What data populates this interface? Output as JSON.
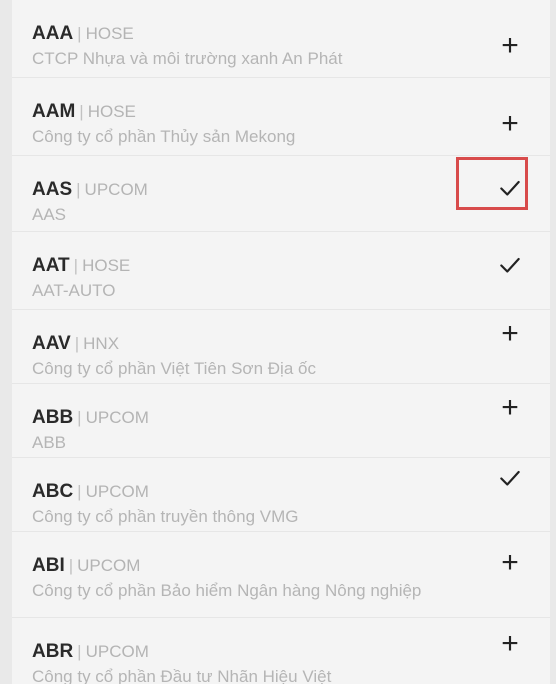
{
  "items": [
    {
      "ticker": "AAA",
      "separator": "|",
      "exchange": "HOSE",
      "name": "CTCP Nhựa và môi trường xanh An Phát",
      "state": "+",
      "icon": "plus-icon"
    },
    {
      "ticker": "AAM",
      "separator": "|",
      "exchange": "HOSE",
      "name": "Công ty cổ phần Thủy sản Mekong",
      "state": "+",
      "icon": "plus-icon"
    },
    {
      "ticker": "AAS",
      "separator": "|",
      "exchange": "UPCOM",
      "name": "AAS",
      "state": "check",
      "icon": "check-icon"
    },
    {
      "ticker": "AAT",
      "separator": "|",
      "exchange": "HOSE",
      "name": "AAT-AUTO",
      "state": "check",
      "icon": "check-icon"
    },
    {
      "ticker": "AAV",
      "separator": "|",
      "exchange": "HNX",
      "name": "Công ty cổ phần Việt Tiên Sơn Địa ốc",
      "state": "+",
      "icon": "plus-icon"
    },
    {
      "ticker": "ABB",
      "separator": "|",
      "exchange": "UPCOM",
      "name": "ABB",
      "state": "+",
      "icon": "plus-icon"
    },
    {
      "ticker": "ABC",
      "separator": "|",
      "exchange": "UPCOM",
      "name": "Công ty cổ phần truyền thông VMG",
      "state": "check",
      "icon": "check-icon"
    },
    {
      "ticker": "ABI",
      "separator": "|",
      "exchange": "UPCOM",
      "name": "Công ty cổ phần Bảo hiểm Ngân hàng Nông nghiệp",
      "state": "+",
      "icon": "plus-icon"
    },
    {
      "ticker": "ABR",
      "separator": "|",
      "exchange": "UPCOM",
      "name": "Công ty cổ phần Đầu tư Nhãn Hiệu Việt",
      "state": "+",
      "icon": "plus-icon"
    }
  ],
  "colors": {
    "highlight": "#d84b4b",
    "ticker": "#2a2a2a",
    "secondary_text": "#b5b5b5"
  },
  "highlighted_item": "AAS"
}
